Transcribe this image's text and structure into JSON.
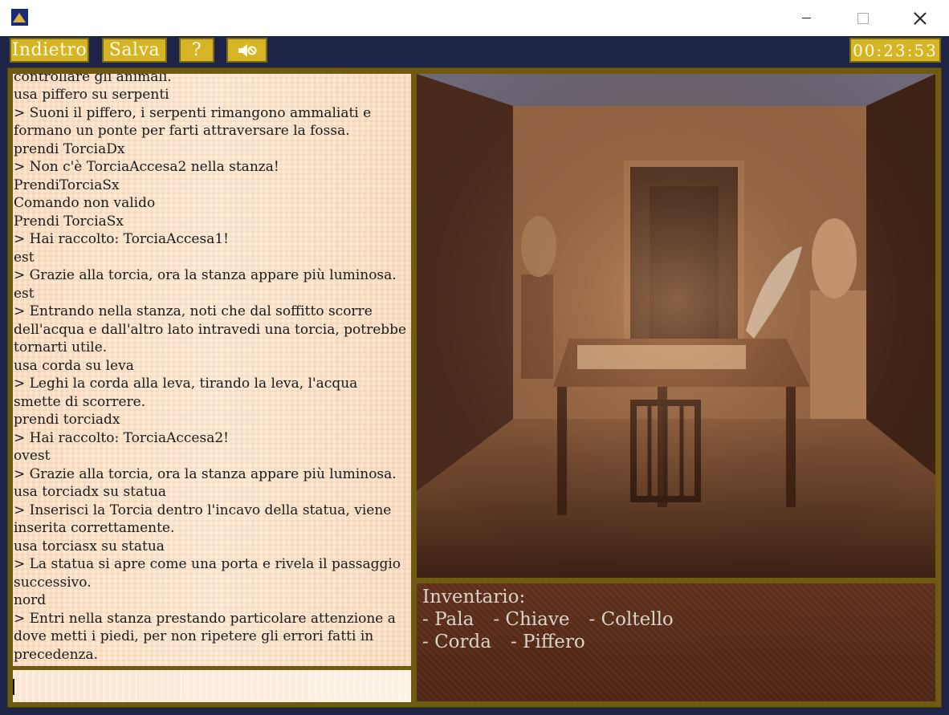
{
  "toolbar": {
    "back_label": "Indietro",
    "save_label": "Salva",
    "help_label": "?",
    "sound_icon": "speaker-mute-icon",
    "timer": "00:23:53"
  },
  "log": {
    "lines": [
      "controllare gli animali.",
      "usa piffero su serpenti",
      "> Suoni il piffero, i serpenti rimangono ammaliati e formano un ponte per farti attraversare la fossa.",
      "prendi TorciaDx",
      "> Non c'è TorciaAccesa2 nella stanza!",
      "PrendiTorciaSx",
      "Comando non valido",
      "Prendi TorciaSx",
      "> Hai raccolto: TorciaAccesa1!",
      "est",
      "> Grazie alla torcia, ora la stanza appare più luminosa.",
      "est",
      "> Entrando nella stanza, noti che dal soffitto scorre dell'acqua e dall'altro lato intravedi una torcia, potrebbe tornarti utile.",
      "usa corda su leva",
      "> Leghi la corda alla leva, tirando la leva, l'acqua smette di scorrere.",
      "prendi torciadx",
      "> Hai raccolto: TorciaAccesa2!",
      "ovest",
      "> Grazie alla torcia, ora la stanza appare più luminosa.",
      "usa torciadx su statua",
      "> Inserisci la Torcia dentro l'incavo della statua, viene inserita correttamente.",
      "usa torciasx su statua",
      "> La statua si apre come una porta e rivela il passaggio successivo.",
      "nord",
      "> Entri nella stanza prestando particolare attenzione a dove metti i piedi, per non ripetere gli errori fatti in precedenza."
    ]
  },
  "input": {
    "value": ""
  },
  "inventory": {
    "title": "Inventario:",
    "items": [
      "- Pala",
      "- Chiave",
      "- Coltello",
      "- Corda",
      "- Piffero"
    ]
  },
  "colors": {
    "background": "#1e2348",
    "button": "#d5b426",
    "frame": "#6e5a10",
    "inventory_bg": "#5e2f1b"
  }
}
